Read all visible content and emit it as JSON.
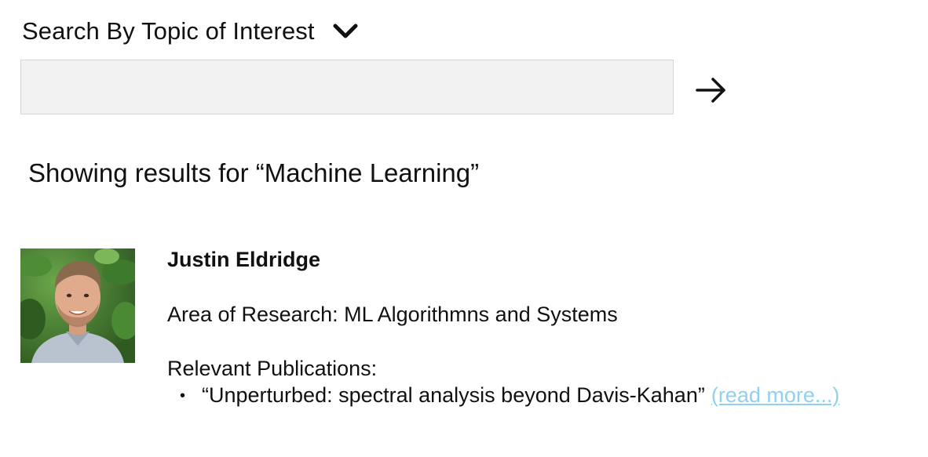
{
  "search": {
    "header_label": "Search By Topic of Interest",
    "input_value": "",
    "placeholder": "",
    "dropdown_icon": "chevron-down-icon",
    "submit_icon": "arrow-right-icon"
  },
  "results": {
    "heading": "Showing results for “Machine Learning”",
    "items": [
      {
        "name": "Justin Eldridge",
        "area": "Area of Research: ML Algorithmns and Systems",
        "publications_label": "Relevant Publications:",
        "publications": [
          {
            "bullet": "•",
            "title": "“Unperturbed: spectral analysis beyond Davis-Kahan”",
            "read_more": "(read more...)"
          }
        ]
      }
    ]
  },
  "colors": {
    "input_background": "#f2f2f2",
    "read_more_link": "#8fd1ee",
    "text": "#111111"
  }
}
